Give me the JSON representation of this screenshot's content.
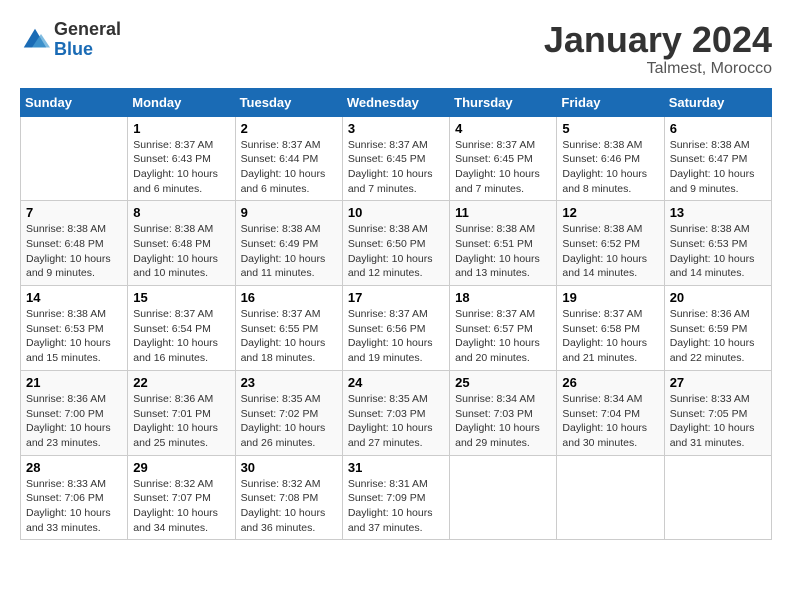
{
  "logo": {
    "general": "General",
    "blue": "Blue"
  },
  "title": "January 2024",
  "location": "Talmest, Morocco",
  "days_header": [
    "Sunday",
    "Monday",
    "Tuesday",
    "Wednesday",
    "Thursday",
    "Friday",
    "Saturday"
  ],
  "weeks": [
    [
      {
        "day": "",
        "sunrise": "",
        "sunset": "",
        "daylight": ""
      },
      {
        "day": "1",
        "sunrise": "Sunrise: 8:37 AM",
        "sunset": "Sunset: 6:43 PM",
        "daylight": "Daylight: 10 hours and 6 minutes."
      },
      {
        "day": "2",
        "sunrise": "Sunrise: 8:37 AM",
        "sunset": "Sunset: 6:44 PM",
        "daylight": "Daylight: 10 hours and 6 minutes."
      },
      {
        "day": "3",
        "sunrise": "Sunrise: 8:37 AM",
        "sunset": "Sunset: 6:45 PM",
        "daylight": "Daylight: 10 hours and 7 minutes."
      },
      {
        "day": "4",
        "sunrise": "Sunrise: 8:37 AM",
        "sunset": "Sunset: 6:45 PM",
        "daylight": "Daylight: 10 hours and 7 minutes."
      },
      {
        "day": "5",
        "sunrise": "Sunrise: 8:38 AM",
        "sunset": "Sunset: 6:46 PM",
        "daylight": "Daylight: 10 hours and 8 minutes."
      },
      {
        "day": "6",
        "sunrise": "Sunrise: 8:38 AM",
        "sunset": "Sunset: 6:47 PM",
        "daylight": "Daylight: 10 hours and 9 minutes."
      }
    ],
    [
      {
        "day": "7",
        "sunrise": "Sunrise: 8:38 AM",
        "sunset": "Sunset: 6:48 PM",
        "daylight": "Daylight: 10 hours and 9 minutes."
      },
      {
        "day": "8",
        "sunrise": "Sunrise: 8:38 AM",
        "sunset": "Sunset: 6:48 PM",
        "daylight": "Daylight: 10 hours and 10 minutes."
      },
      {
        "day": "9",
        "sunrise": "Sunrise: 8:38 AM",
        "sunset": "Sunset: 6:49 PM",
        "daylight": "Daylight: 10 hours and 11 minutes."
      },
      {
        "day": "10",
        "sunrise": "Sunrise: 8:38 AM",
        "sunset": "Sunset: 6:50 PM",
        "daylight": "Daylight: 10 hours and 12 minutes."
      },
      {
        "day": "11",
        "sunrise": "Sunrise: 8:38 AM",
        "sunset": "Sunset: 6:51 PM",
        "daylight": "Daylight: 10 hours and 13 minutes."
      },
      {
        "day": "12",
        "sunrise": "Sunrise: 8:38 AM",
        "sunset": "Sunset: 6:52 PM",
        "daylight": "Daylight: 10 hours and 14 minutes."
      },
      {
        "day": "13",
        "sunrise": "Sunrise: 8:38 AM",
        "sunset": "Sunset: 6:53 PM",
        "daylight": "Daylight: 10 hours and 14 minutes."
      }
    ],
    [
      {
        "day": "14",
        "sunrise": "Sunrise: 8:38 AM",
        "sunset": "Sunset: 6:53 PM",
        "daylight": "Daylight: 10 hours and 15 minutes."
      },
      {
        "day": "15",
        "sunrise": "Sunrise: 8:37 AM",
        "sunset": "Sunset: 6:54 PM",
        "daylight": "Daylight: 10 hours and 16 minutes."
      },
      {
        "day": "16",
        "sunrise": "Sunrise: 8:37 AM",
        "sunset": "Sunset: 6:55 PM",
        "daylight": "Daylight: 10 hours and 18 minutes."
      },
      {
        "day": "17",
        "sunrise": "Sunrise: 8:37 AM",
        "sunset": "Sunset: 6:56 PM",
        "daylight": "Daylight: 10 hours and 19 minutes."
      },
      {
        "day": "18",
        "sunrise": "Sunrise: 8:37 AM",
        "sunset": "Sunset: 6:57 PM",
        "daylight": "Daylight: 10 hours and 20 minutes."
      },
      {
        "day": "19",
        "sunrise": "Sunrise: 8:37 AM",
        "sunset": "Sunset: 6:58 PM",
        "daylight": "Daylight: 10 hours and 21 minutes."
      },
      {
        "day": "20",
        "sunrise": "Sunrise: 8:36 AM",
        "sunset": "Sunset: 6:59 PM",
        "daylight": "Daylight: 10 hours and 22 minutes."
      }
    ],
    [
      {
        "day": "21",
        "sunrise": "Sunrise: 8:36 AM",
        "sunset": "Sunset: 7:00 PM",
        "daylight": "Daylight: 10 hours and 23 minutes."
      },
      {
        "day": "22",
        "sunrise": "Sunrise: 8:36 AM",
        "sunset": "Sunset: 7:01 PM",
        "daylight": "Daylight: 10 hours and 25 minutes."
      },
      {
        "day": "23",
        "sunrise": "Sunrise: 8:35 AM",
        "sunset": "Sunset: 7:02 PM",
        "daylight": "Daylight: 10 hours and 26 minutes."
      },
      {
        "day": "24",
        "sunrise": "Sunrise: 8:35 AM",
        "sunset": "Sunset: 7:03 PM",
        "daylight": "Daylight: 10 hours and 27 minutes."
      },
      {
        "day": "25",
        "sunrise": "Sunrise: 8:34 AM",
        "sunset": "Sunset: 7:03 PM",
        "daylight": "Daylight: 10 hours and 29 minutes."
      },
      {
        "day": "26",
        "sunrise": "Sunrise: 8:34 AM",
        "sunset": "Sunset: 7:04 PM",
        "daylight": "Daylight: 10 hours and 30 minutes."
      },
      {
        "day": "27",
        "sunrise": "Sunrise: 8:33 AM",
        "sunset": "Sunset: 7:05 PM",
        "daylight": "Daylight: 10 hours and 31 minutes."
      }
    ],
    [
      {
        "day": "28",
        "sunrise": "Sunrise: 8:33 AM",
        "sunset": "Sunset: 7:06 PM",
        "daylight": "Daylight: 10 hours and 33 minutes."
      },
      {
        "day": "29",
        "sunrise": "Sunrise: 8:32 AM",
        "sunset": "Sunset: 7:07 PM",
        "daylight": "Daylight: 10 hours and 34 minutes."
      },
      {
        "day": "30",
        "sunrise": "Sunrise: 8:32 AM",
        "sunset": "Sunset: 7:08 PM",
        "daylight": "Daylight: 10 hours and 36 minutes."
      },
      {
        "day": "31",
        "sunrise": "Sunrise: 8:31 AM",
        "sunset": "Sunset: 7:09 PM",
        "daylight": "Daylight: 10 hours and 37 minutes."
      },
      {
        "day": "",
        "sunrise": "",
        "sunset": "",
        "daylight": ""
      },
      {
        "day": "",
        "sunrise": "",
        "sunset": "",
        "daylight": ""
      },
      {
        "day": "",
        "sunrise": "",
        "sunset": "",
        "daylight": ""
      }
    ]
  ]
}
